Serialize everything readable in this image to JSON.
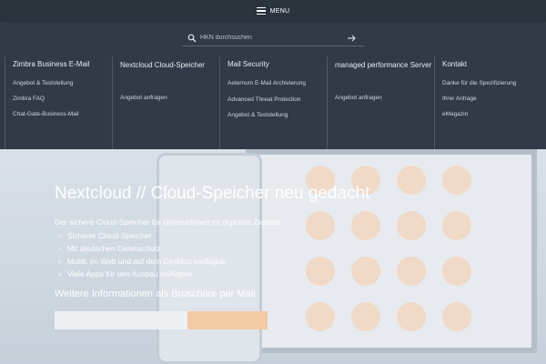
{
  "menubar": {
    "label": "MENU",
    "icon": "hamburger-icon"
  },
  "search": {
    "placeholder": "HKN durchsuchen",
    "icon": "search-icon",
    "submit_icon": "arrow-right-icon"
  },
  "columns": [
    {
      "title": "Zimbra Business E-Mail",
      "links": [
        "Angebot & Teststellung",
        "Zimbra FAQ",
        "Chat-Gate-Business-Mail"
      ]
    },
    {
      "title": "Nextcloud Cloud-Speicher",
      "links": [
        "Angebot anfragen"
      ]
    },
    {
      "title": "Mail Security",
      "links": [
        "Aeternum E-Mail Archivierung",
        "Advanced Threat Protection",
        "Angebot & Teststellung"
      ]
    },
    {
      "title": "managed performance Server",
      "links": [
        "Angebot anfragen"
      ]
    },
    {
      "title": "Kontakt",
      "links": [
        "Danke für die Spezifizierung",
        "Ihrer Anfrage",
        "eMagazin"
      ]
    }
  ],
  "hero": {
    "title": "Nextcloud // Cloud-Speicher neu gedacht",
    "subtitle": "Der sichere Cloud-Speicher für Unternehmen im digitalen Zeitalter",
    "bullets": [
      "Sicherer Cloud-Speicher",
      "Mit deutschen Datenschutz",
      "Mobil, im Web und auf dem Desktop verfügbar",
      "Viele Apps für den Ausbau verfügbar"
    ],
    "more": "Weitere Informationen als Broschüre per Mail"
  },
  "colors": {
    "panel": "#303b47",
    "menubar": "#2b333d",
    "accent": "#f4c9a3"
  }
}
